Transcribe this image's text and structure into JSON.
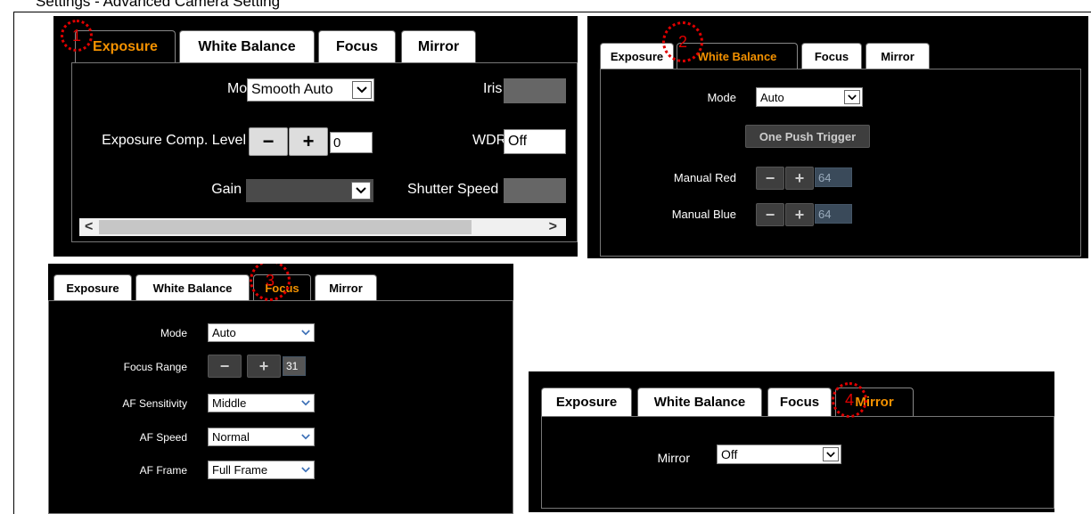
{
  "page_title": "Settings - Advanced Camera Setting",
  "colors": {
    "panel_bg": "#000000",
    "active_tab": "#f39100",
    "marker": "#e00000"
  },
  "panel1": {
    "marker": "1",
    "tabs": [
      "Exposure",
      "White Balance",
      "Focus",
      "Mirror"
    ],
    "active_tab": "Exposure",
    "mode_label": "Mode",
    "mode_value": "Smooth Auto",
    "exposure_comp_label": "Exposure Comp. Level",
    "exposure_comp_value": "0",
    "gain_label": "Gain",
    "iris_label": "Iris",
    "wdr_label": "WDR",
    "wdr_value": "Off",
    "shutter_label": "Shutter Speed",
    "minus": "−",
    "plus": "+",
    "scroll_left": "<",
    "scroll_right": ">"
  },
  "panel2": {
    "marker": "2",
    "tabs": [
      "Exposure",
      "White Balance",
      "Focus",
      "Mirror"
    ],
    "active_tab": "White Balance",
    "mode_label": "Mode",
    "mode_value": "Auto",
    "one_push": "One Push Trigger",
    "manual_red_label": "Manual Red",
    "manual_red_value": "64",
    "manual_blue_label": "Manual Blue",
    "manual_blue_value": "64",
    "minus": "−",
    "plus": "+"
  },
  "panel3": {
    "marker": "3",
    "tabs": [
      "Exposure",
      "White Balance",
      "Focus",
      "Mirror"
    ],
    "active_tab": "Focus",
    "mode_label": "Mode",
    "mode_value": "Auto",
    "focus_range_label": "Focus Range",
    "focus_range_value": "31",
    "af_sensitivity_label": "AF Sensitivity",
    "af_sensitivity_value": "Middle",
    "af_speed_label": "AF Speed",
    "af_speed_value": "Normal",
    "af_frame_label": "AF Frame",
    "af_frame_value": "Full Frame",
    "minus": "−",
    "plus": "+"
  },
  "panel4": {
    "marker": "4",
    "tabs": [
      "Exposure",
      "White Balance",
      "Focus",
      "Mirror"
    ],
    "active_tab": "Mirror",
    "mirror_label": "Mirror",
    "mirror_value": "Off"
  },
  "icons": {
    "dropdown": "chevron-down-icon"
  }
}
